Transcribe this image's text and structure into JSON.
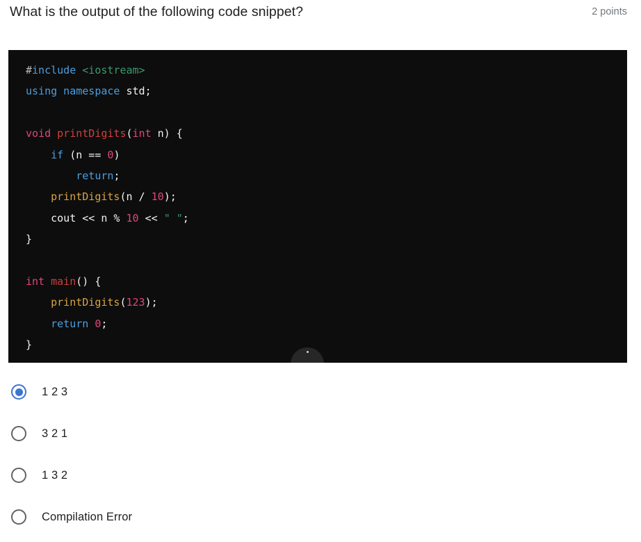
{
  "question": {
    "title": "What is the output of the following code snippet?",
    "points": "2 points"
  },
  "code_block": {
    "language": "cpp",
    "background": "#0d0d0d",
    "lines": [
      [
        {
          "t": "#",
          "c": "hash"
        },
        {
          "t": "include",
          "c": "kw"
        },
        {
          "t": " ",
          "c": "plain"
        },
        {
          "t": "<iostream>",
          "c": "str"
        }
      ],
      [
        {
          "t": "using namespace",
          "c": "kw"
        },
        {
          "t": " std;",
          "c": "plain"
        }
      ],
      [],
      [
        {
          "t": "void",
          "c": "type"
        },
        {
          "t": " ",
          "c": "plain"
        },
        {
          "t": "printDigits",
          "c": "fndef"
        },
        {
          "t": "(",
          "c": "plain"
        },
        {
          "t": "int",
          "c": "type"
        },
        {
          "t": " n) {",
          "c": "plain"
        }
      ],
      [
        {
          "t": "    ",
          "c": "plain"
        },
        {
          "t": "if",
          "c": "kw"
        },
        {
          "t": " (n == ",
          "c": "plain"
        },
        {
          "t": "0",
          "c": "num"
        },
        {
          "t": ")",
          "c": "plain"
        }
      ],
      [
        {
          "t": "        ",
          "c": "plain"
        },
        {
          "t": "return",
          "c": "kw"
        },
        {
          "t": ";",
          "c": "plain"
        }
      ],
      [
        {
          "t": "    ",
          "c": "plain"
        },
        {
          "t": "printDigits",
          "c": "fncall"
        },
        {
          "t": "(n / ",
          "c": "plain"
        },
        {
          "t": "10",
          "c": "num"
        },
        {
          "t": ");",
          "c": "plain"
        }
      ],
      [
        {
          "t": "    cout << n % ",
          "c": "plain"
        },
        {
          "t": "10",
          "c": "num"
        },
        {
          "t": " << ",
          "c": "plain"
        },
        {
          "t": "\" \"",
          "c": "str"
        },
        {
          "t": ";",
          "c": "plain"
        }
      ],
      [
        {
          "t": "}",
          "c": "plain"
        }
      ],
      [],
      [
        {
          "t": "int",
          "c": "type"
        },
        {
          "t": " ",
          "c": "plain"
        },
        {
          "t": "main",
          "c": "fndef"
        },
        {
          "t": "() {",
          "c": "plain"
        }
      ],
      [
        {
          "t": "    ",
          "c": "plain"
        },
        {
          "t": "printDigits",
          "c": "fncall"
        },
        {
          "t": "(",
          "c": "plain"
        },
        {
          "t": "123",
          "c": "num"
        },
        {
          "t": ");",
          "c": "plain"
        }
      ],
      [
        {
          "t": "    ",
          "c": "plain"
        },
        {
          "t": "return",
          "c": "kw"
        },
        {
          "t": " ",
          "c": "plain"
        },
        {
          "t": "0",
          "c": "num"
        },
        {
          "t": ";",
          "c": "plain"
        }
      ],
      [
        {
          "t": "}",
          "c": "plain"
        }
      ]
    ]
  },
  "options": {
    "selected_index": 0,
    "items": [
      {
        "label": "1 2 3"
      },
      {
        "label": "3 2 1"
      },
      {
        "label": "1 3 2"
      },
      {
        "label": "Compilation Error"
      }
    ]
  },
  "colors": {
    "accent": "#3b76cf",
    "radio_unselected": "#5f6368",
    "text": "#202124",
    "muted": "#74787c",
    "code_bg": "#0d0d0d"
  }
}
